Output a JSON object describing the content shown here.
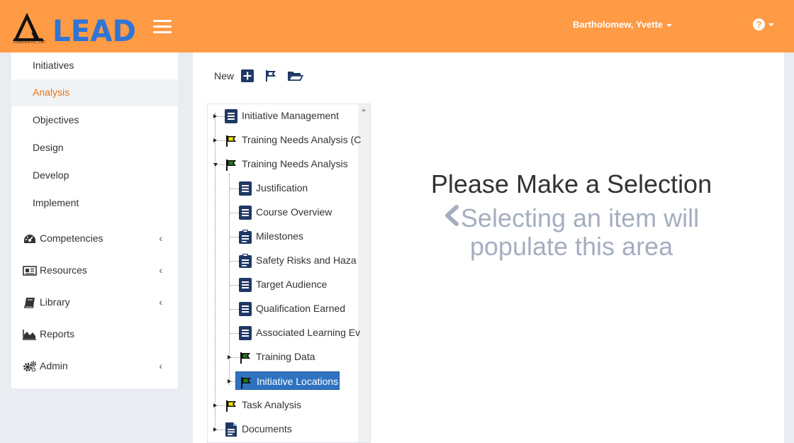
{
  "header": {
    "brand": "LEAD",
    "company": "AIMERION, INC",
    "user_name": "Bartholomew, Yvette",
    "help_symbol": "?",
    "menu_icon": "hamburger-icon",
    "colors": {
      "header": "#ff9a45",
      "brand_blue": "#2f75d6",
      "accent": "#e8731b"
    }
  },
  "sidebar": {
    "sub_items": [
      {
        "label": "Initiatives",
        "active": false
      },
      {
        "label": "Analysis",
        "active": true
      },
      {
        "label": "Objectives",
        "active": false
      },
      {
        "label": "Design",
        "active": false
      },
      {
        "label": "Develop",
        "active": false
      },
      {
        "label": "Implement",
        "active": false
      }
    ],
    "main_items": [
      {
        "label": "Competencies",
        "icon": "dashboard-icon",
        "chevron": "‹"
      },
      {
        "label": "Resources",
        "icon": "newspaper-icon",
        "chevron": "‹"
      },
      {
        "label": "Library",
        "icon": "book-icon",
        "chevron": "‹"
      },
      {
        "label": "Reports",
        "icon": "area-chart-icon"
      },
      {
        "label": "Admin",
        "icon": "gears-icon",
        "chevron": "‹"
      }
    ]
  },
  "toolbar": {
    "new_label": "New",
    "buttons": [
      "plus-icon",
      "flag-icon",
      "folder-open-icon"
    ]
  },
  "tree": {
    "nodes": [
      {
        "label": "Initiative Management",
        "icon": "list-icon",
        "level": 0,
        "toggle": "closed"
      },
      {
        "label": "Training Needs Analysis (C",
        "icon": "flag-yellow-icon",
        "level": 0,
        "toggle": "closed"
      },
      {
        "label": "Training Needs Analysis",
        "icon": "flag-green-icon",
        "level": 0,
        "toggle": "open"
      },
      {
        "label": "Justification",
        "icon": "list-icon",
        "level": 1
      },
      {
        "label": "Course Overview",
        "icon": "list-icon",
        "level": 1
      },
      {
        "label": "Milestones",
        "icon": "clipboard-icon",
        "level": 1
      },
      {
        "label": "Safety Risks and Haza",
        "icon": "clipboard-icon",
        "level": 1
      },
      {
        "label": "Target Audience",
        "icon": "list-icon",
        "level": 1
      },
      {
        "label": "Qualification Earned",
        "icon": "list-icon",
        "level": 1
      },
      {
        "label": "Associated Learning Ev",
        "icon": "list-icon",
        "level": 1
      },
      {
        "label": "Training Data",
        "icon": "flag-green-icon",
        "level": 1,
        "toggle": "closed"
      },
      {
        "label": "Initiative Locations",
        "icon": "flag-green-icon",
        "level": 1,
        "toggle": "closed",
        "selected": true
      },
      {
        "label": "Task Analysis",
        "icon": "flag-yellow-icon",
        "level": 0,
        "toggle": "closed"
      },
      {
        "label": "Documents",
        "icon": "document-icon",
        "level": 0,
        "toggle": "closed"
      }
    ],
    "colors": {
      "icon_navy": "#1f3864",
      "flag_yellow": "#f2e600",
      "flag_green": "#1f7a1f",
      "selected": "#2f73c0"
    }
  },
  "placeholder": {
    "title": "Please Make a Selection",
    "subtitle_line1": "Selecting an item will",
    "subtitle_line2": "populate this area",
    "arrow_icon": "chevron-left-icon"
  }
}
